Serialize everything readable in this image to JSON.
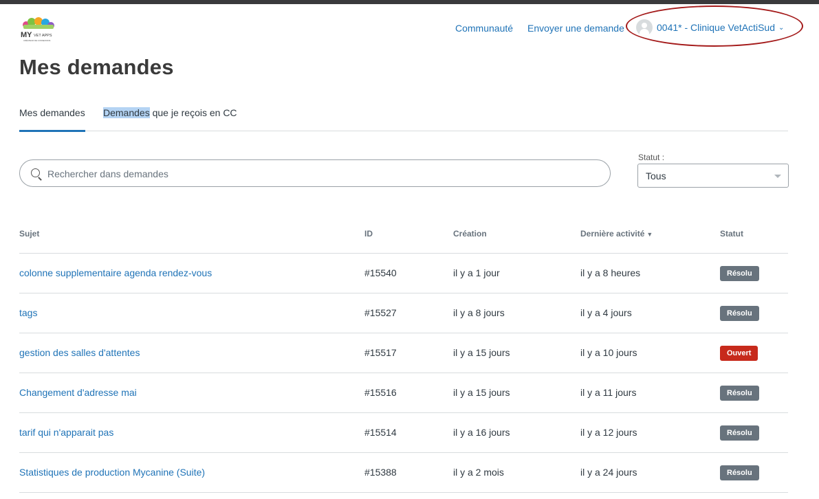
{
  "header": {
    "logo_text": "MY VET APPS",
    "logo_tagline": "CRÉATEUR DE CONNEXIONS",
    "nav": [
      {
        "label": "Communauté"
      },
      {
        "label": "Envoyer une demande"
      }
    ],
    "user": {
      "name": "0041* - Clinique VetActiSud",
      "icon": "user-avatar-icon"
    }
  },
  "page_title": "Mes demandes",
  "tabs": [
    {
      "label": "Mes demandes",
      "active": true
    },
    {
      "label_highlighted": "Demandes",
      "label_rest": " que je reçois en CC",
      "active": false
    }
  ],
  "search": {
    "placeholder": "Rechercher dans demandes",
    "value": "",
    "icon": "search-icon"
  },
  "status_filter": {
    "label": "Statut :",
    "selected": "Tous"
  },
  "table": {
    "headers": {
      "subject": "Sujet",
      "id": "ID",
      "created": "Création",
      "last_activity": "Dernière activité",
      "status": "Statut"
    },
    "sort_indicator": "▼",
    "rows": [
      {
        "subject": "colonne supplementaire agenda rendez-vous",
        "id": "#15540",
        "created": "il y a 1 jour",
        "last_activity": "il y a 8 heures",
        "status": "Résolu",
        "status_type": "solved"
      },
      {
        "subject": "tags",
        "id": "#15527",
        "created": "il y a 8 jours",
        "last_activity": "il y a 4 jours",
        "status": "Résolu",
        "status_type": "solved"
      },
      {
        "subject": "gestion des salles d'attentes",
        "id": "#15517",
        "created": "il y a 15 jours",
        "last_activity": "il y a 10 jours",
        "status": "Ouvert",
        "status_type": "open"
      },
      {
        "subject": "Changement d'adresse mai",
        "id": "#15516",
        "created": "il y a 15 jours",
        "last_activity": "il y a 11 jours",
        "status": "Résolu",
        "status_type": "solved"
      },
      {
        "subject": "tarif qui n'apparait pas",
        "id": "#15514",
        "created": "il y a 16 jours",
        "last_activity": "il y a 12 jours",
        "status": "Résolu",
        "status_type": "solved"
      },
      {
        "subject": "Statistiques de production Mycanine (Suite)",
        "id": "#15388",
        "created": "il y a 2 mois",
        "last_activity": "il y a 24 jours",
        "status": "Résolu",
        "status_type": "solved"
      }
    ]
  },
  "colors": {
    "link": "#1f73b7",
    "solved_badge": "#68737d",
    "open_badge": "#c72a1c",
    "annotation": "#a41a1a"
  }
}
